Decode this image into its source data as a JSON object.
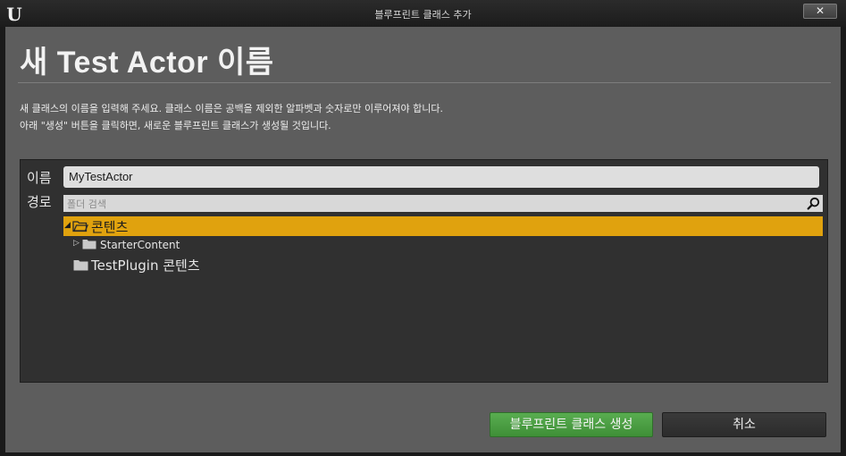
{
  "window": {
    "title": "블루프린트 클래스 추가",
    "close_glyph": "✕",
    "logo_glyph": "U"
  },
  "header": {
    "title": "새 Test Actor 이름"
  },
  "description": {
    "line1": "새 클래스의 이름을 입력해 주세요. 클래스 이름은 공백을 제외한 알파벳과 숫자로만 이루어져야 합니다.",
    "line2": "아래 \"생성\" 버튼을 클릭하면, 새로운 블루프린트 클래스가 생성될 것입니다."
  },
  "form": {
    "name_label": "이름",
    "name_value": "MyTestActor",
    "path_label": "경로",
    "search_placeholder": "폴더 검색"
  },
  "tree": {
    "items": [
      {
        "label": "콘텐츠",
        "expanded": true,
        "selected": true,
        "icon": "folder-open-icon"
      },
      {
        "label": "StarterContent",
        "expanded": false,
        "selected": false,
        "icon": "folder-icon"
      },
      {
        "label": "TestPlugin 콘텐츠",
        "expanded": false,
        "selected": false,
        "icon": "folder-icon"
      }
    ]
  },
  "buttons": {
    "create_label": "블루프린트 클래스 생성",
    "cancel_label": "취소"
  },
  "colors": {
    "selection": "#e0a20e",
    "create_button": "#4a9e42",
    "panel": "#5d5d5d",
    "tree_background": "#303030"
  }
}
